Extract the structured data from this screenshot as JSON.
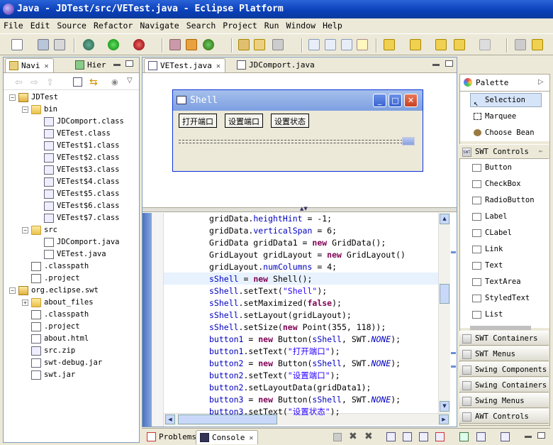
{
  "window": {
    "title": "Java - JDTest/src/VETest.java - Eclipse Platform"
  },
  "menu": [
    "File",
    "Edit",
    "Source",
    "Refactor",
    "Navigate",
    "Search",
    "Project",
    "Run",
    "Window",
    "Help"
  ],
  "left_panel": {
    "tabs": [
      {
        "label": "Navi"
      },
      {
        "label": "Hier"
      }
    ],
    "tree": [
      {
        "label": "JDTest",
        "indent": 0,
        "icon": "project-folder-icon",
        "expander": "−"
      },
      {
        "label": "bin",
        "indent": 1,
        "icon": "folder-icon",
        "expander": "−"
      },
      {
        "label": "JDComport.class",
        "indent": 2,
        "icon": "class-file-icon"
      },
      {
        "label": "VETest.class",
        "indent": 2,
        "icon": "class-file-icon"
      },
      {
        "label": "VETest$1.class",
        "indent": 2,
        "icon": "class-file-icon"
      },
      {
        "label": "VETest$2.class",
        "indent": 2,
        "icon": "class-file-icon"
      },
      {
        "label": "VETest$3.class",
        "indent": 2,
        "icon": "class-file-icon"
      },
      {
        "label": "VETest$4.class",
        "indent": 2,
        "icon": "class-file-icon"
      },
      {
        "label": "VETest$5.class",
        "indent": 2,
        "icon": "class-file-icon"
      },
      {
        "label": "VETest$6.class",
        "indent": 2,
        "icon": "class-file-icon"
      },
      {
        "label": "VETest$7.class",
        "indent": 2,
        "icon": "class-file-icon"
      },
      {
        "label": "src",
        "indent": 1,
        "icon": "folder-icon",
        "expander": "−"
      },
      {
        "label": "JDComport.java",
        "indent": 2,
        "icon": "java-file-icon"
      },
      {
        "label": "VETest.java",
        "indent": 2,
        "icon": "java-file-icon"
      },
      {
        "label": ".classpath",
        "indent": 1,
        "icon": "xml-file-icon"
      },
      {
        "label": ".project",
        "indent": 1,
        "icon": "xml-file-icon"
      },
      {
        "label": "org.eclipse.swt",
        "indent": 0,
        "icon": "project-folder-icon",
        "expander": "−"
      },
      {
        "label": "about_files",
        "indent": 1,
        "icon": "folder-icon",
        "expander": "+"
      },
      {
        "label": ".classpath",
        "indent": 1,
        "icon": "xml-file-icon"
      },
      {
        "label": ".project",
        "indent": 1,
        "icon": "xml-file-icon"
      },
      {
        "label": "about.html",
        "indent": 1,
        "icon": "html-file-icon"
      },
      {
        "label": "src.zip",
        "indent": 1,
        "icon": "zip-file-icon"
      },
      {
        "label": "swt-debug.jar",
        "indent": 1,
        "icon": "jar-file-icon"
      },
      {
        "label": "swt.jar",
        "indent": 1,
        "icon": "jar-file-icon"
      }
    ]
  },
  "editor": {
    "tabs": [
      {
        "label": "VETest.java",
        "active": true
      },
      {
        "label": "JDComport.java",
        "active": false
      }
    ],
    "shell_preview": {
      "title": "Shell",
      "buttons": [
        "打开端口",
        "设置端口",
        "设置状态"
      ]
    },
    "code_lines": [
      [
        {
          "t": "gridData.",
          "c": ""
        },
        {
          "t": "heightHint",
          "c": "fld"
        },
        {
          "t": " = -1;",
          "c": ""
        }
      ],
      [
        {
          "t": "gridData.",
          "c": ""
        },
        {
          "t": "verticalSpan",
          "c": "fld"
        },
        {
          "t": " = 6;",
          "c": ""
        }
      ],
      [
        {
          "t": "GridData gridData1 = ",
          "c": ""
        },
        {
          "t": "new",
          "c": "kw"
        },
        {
          "t": " GridData();",
          "c": ""
        }
      ],
      [
        {
          "t": "GridLayout gridLayout = ",
          "c": ""
        },
        {
          "t": "new",
          "c": "kw"
        },
        {
          "t": " GridLayout()",
          "c": ""
        }
      ],
      [
        {
          "t": "gridLayout.",
          "c": ""
        },
        {
          "t": "numColumns",
          "c": "fld"
        },
        {
          "t": " = 4;",
          "c": ""
        }
      ],
      [
        {
          "t": "sShell",
          "c": "fld"
        },
        {
          "t": " = ",
          "c": ""
        },
        {
          "t": "new",
          "c": "kw"
        },
        {
          "t": " Shell();",
          "c": ""
        }
      ],
      [
        {
          "t": "sShell",
          "c": "fld"
        },
        {
          "t": ".setText(",
          "c": ""
        },
        {
          "t": "\"Shell\"",
          "c": "str"
        },
        {
          "t": ");",
          "c": ""
        }
      ],
      [
        {
          "t": "sShell",
          "c": "fld"
        },
        {
          "t": ".setMaximized(",
          "c": ""
        },
        {
          "t": "false",
          "c": "kw"
        },
        {
          "t": ");",
          "c": ""
        }
      ],
      [
        {
          "t": "sShell",
          "c": "fld"
        },
        {
          "t": ".setLayout(gridLayout);",
          "c": ""
        }
      ],
      [
        {
          "t": "sShell",
          "c": "fld"
        },
        {
          "t": ".setSize(",
          "c": ""
        },
        {
          "t": "new",
          "c": "kw"
        },
        {
          "t": " Point(355, 118));",
          "c": ""
        }
      ],
      [
        {
          "t": "button1",
          "c": "fld"
        },
        {
          "t": " = ",
          "c": ""
        },
        {
          "t": "new",
          "c": "kw"
        },
        {
          "t": " Button(",
          "c": ""
        },
        {
          "t": "sShell",
          "c": "fld"
        },
        {
          "t": ", SWT.",
          "c": ""
        },
        {
          "t": "NONE",
          "c": "const"
        },
        {
          "t": ");",
          "c": ""
        }
      ],
      [
        {
          "t": "button1",
          "c": "fld"
        },
        {
          "t": ".setText(",
          "c": ""
        },
        {
          "t": "\"打开端口\"",
          "c": "str"
        },
        {
          "t": ");",
          "c": ""
        }
      ],
      [
        {
          "t": "button2",
          "c": "fld"
        },
        {
          "t": " = ",
          "c": ""
        },
        {
          "t": "new",
          "c": "kw"
        },
        {
          "t": " Button(",
          "c": ""
        },
        {
          "t": "sShell",
          "c": "fld"
        },
        {
          "t": ", SWT.",
          "c": ""
        },
        {
          "t": "NONE",
          "c": "const"
        },
        {
          "t": ");",
          "c": ""
        }
      ],
      [
        {
          "t": "button2",
          "c": "fld"
        },
        {
          "t": ".setText(",
          "c": ""
        },
        {
          "t": "\"设置端口\"",
          "c": "str"
        },
        {
          "t": ");",
          "c": ""
        }
      ],
      [
        {
          "t": "button2",
          "c": "fld"
        },
        {
          "t": ".setLayoutData(gridData1);",
          "c": ""
        }
      ],
      [
        {
          "t": "button3",
          "c": "fld"
        },
        {
          "t": " = ",
          "c": ""
        },
        {
          "t": "new",
          "c": "kw"
        },
        {
          "t": " Button(",
          "c": ""
        },
        {
          "t": "sShell",
          "c": "fld"
        },
        {
          "t": ", SWT.",
          "c": ""
        },
        {
          "t": "NONE",
          "c": "const"
        },
        {
          "t": ");",
          "c": ""
        }
      ],
      [
        {
          "t": "button3",
          "c": "fld"
        },
        {
          "t": ".setText(",
          "c": ""
        },
        {
          "t": "\"设置状态\"",
          "c": "str"
        },
        {
          "t": ");",
          "c": ""
        }
      ]
    ],
    "highlight_line": 5
  },
  "palette": {
    "title": "Palette",
    "tools": [
      {
        "label": "Selection",
        "selected": true
      },
      {
        "label": "Marquee",
        "selected": false
      },
      {
        "label": "Choose Bean",
        "selected": false
      }
    ],
    "swt_controls_label": "SWT Controls",
    "controls": [
      "Button",
      "CheckBox",
      "RadioButton",
      "Label",
      "CLabel",
      "Link",
      "Text",
      "TextArea",
      "StyledText",
      "List"
    ],
    "drawers": [
      "SWT Containers",
      "SWT Menus",
      "Swing Components",
      "Swing Containers",
      "Swing Menus",
      "AWT Controls"
    ]
  },
  "bottom_panel": {
    "tabs": [
      {
        "label": "Problems",
        "active": false
      },
      {
        "label": "Console",
        "active": true
      }
    ]
  }
}
